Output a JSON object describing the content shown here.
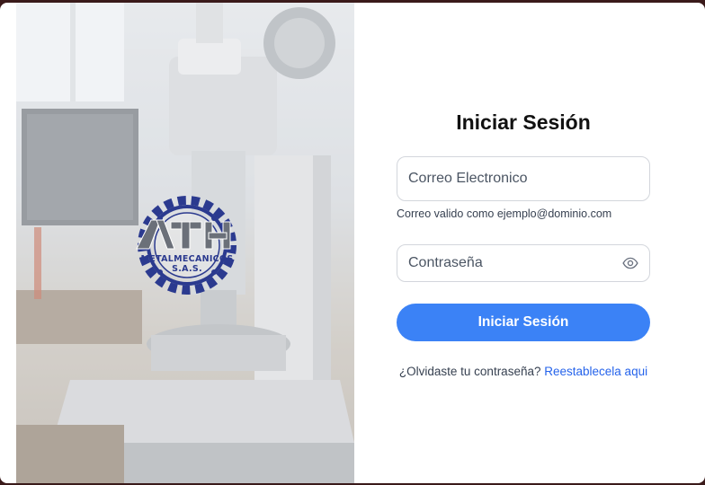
{
  "hero": {
    "image": "industrial-milling-machine-background",
    "logo_text": "METALMECANICOS S.A.S."
  },
  "form": {
    "title": "Iniciar Sesión",
    "email_placeholder": "Correo Electronico",
    "email_hint": "Correo valido como ejemplo@dominio.com",
    "password_placeholder": "Contraseña",
    "password_toggle_icon": "eye-icon",
    "submit_label": "Iniciar Sesión",
    "forgot_text": "¿Olvidaste tu contraseña?",
    "reset_link": "Reestablecela aqui"
  },
  "colors": {
    "primary": "#3b82f6",
    "link": "#2563eb",
    "logo_blue": "#2b3a8f"
  }
}
